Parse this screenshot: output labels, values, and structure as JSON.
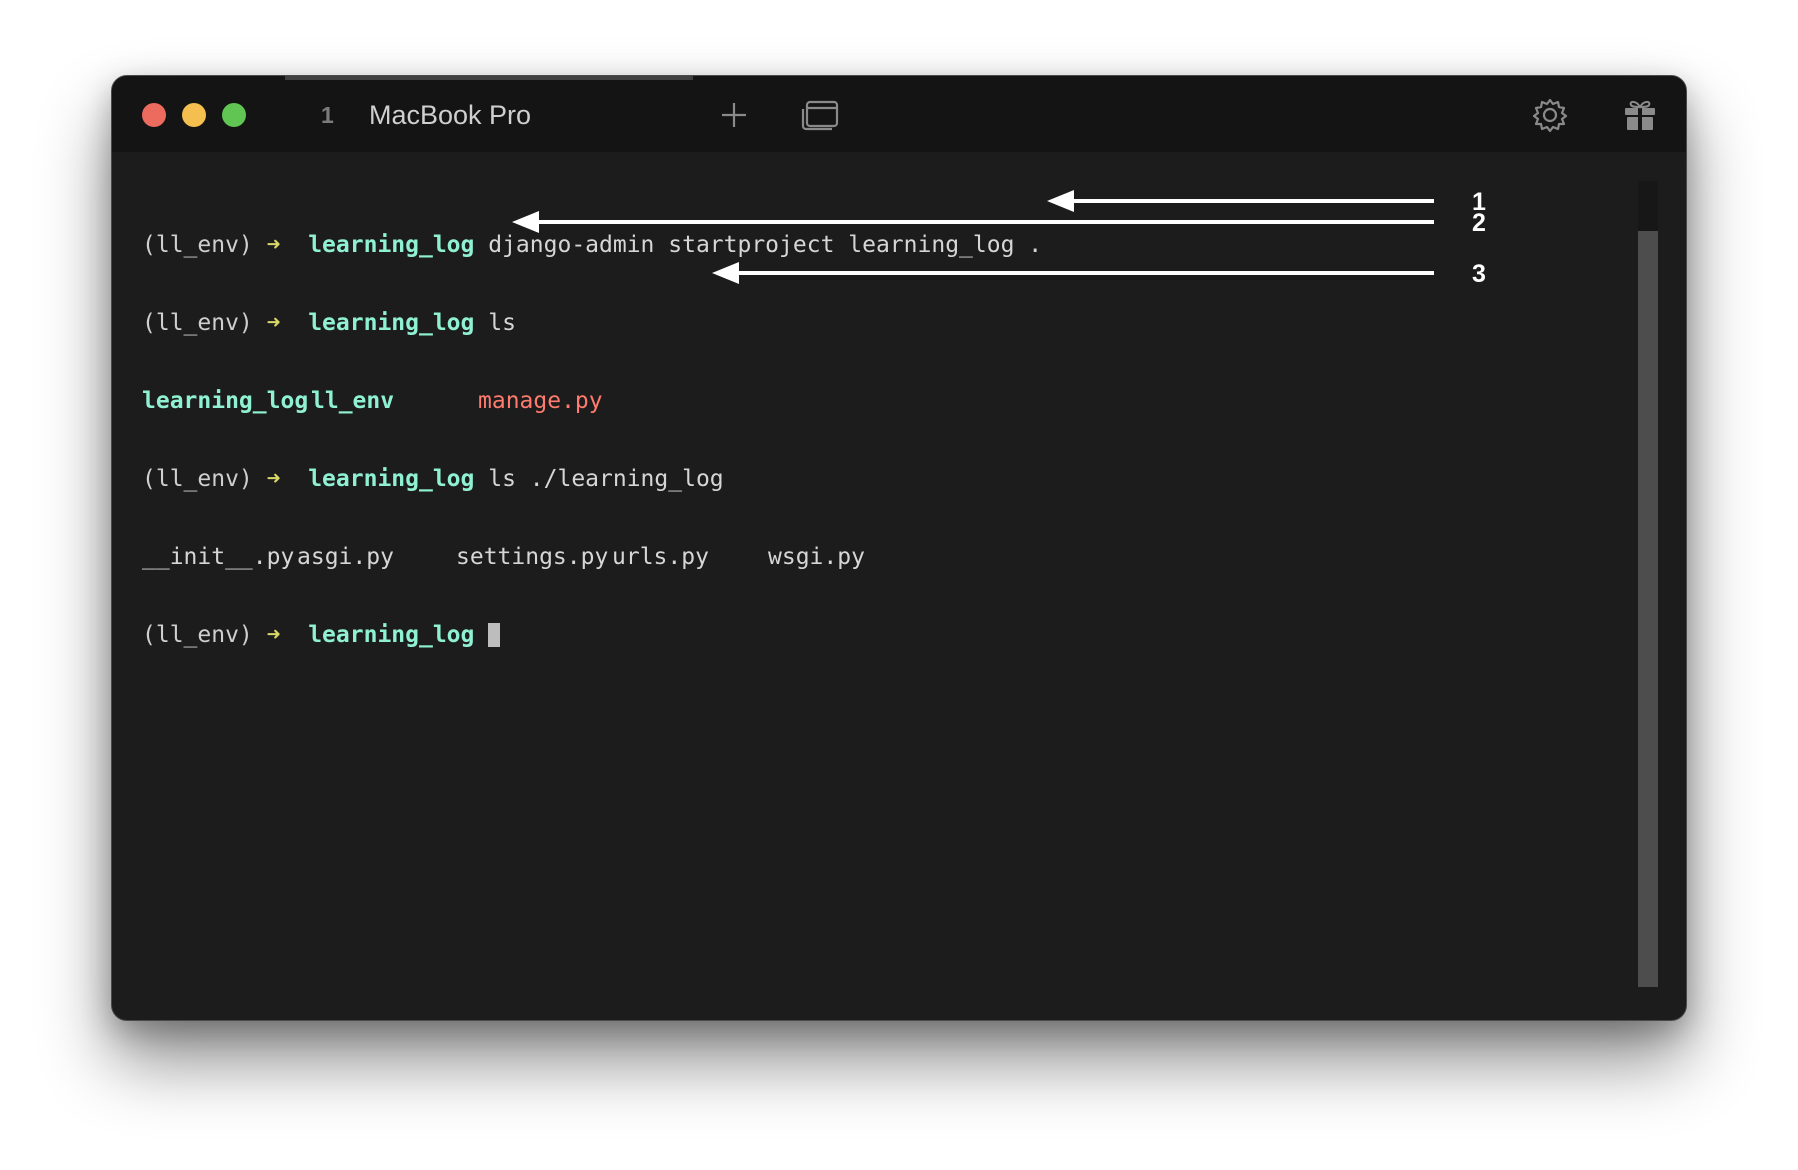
{
  "window": {
    "tab": {
      "index": "1",
      "title": "MacBook Pro"
    },
    "icons": [
      "close-button",
      "minimize-button",
      "maximize-button",
      "plus-icon",
      "window-icon",
      "gear-icon",
      "gift-icon"
    ]
  },
  "terminal": {
    "lines": [
      {
        "env": "(ll_env)",
        "arrow": "➜",
        "dir": "learning_log",
        "cmd": "django-admin startproject learning_log ."
      },
      {
        "env": "(ll_env)",
        "arrow": "➜",
        "dir": "learning_log",
        "cmd": "ls"
      },
      {
        "out": [
          "learning_log",
          "ll_env",
          "manage.py"
        ]
      },
      {
        "env": "(ll_env)",
        "arrow": "➜",
        "dir": "learning_log",
        "cmd": "ls ./learning_log"
      },
      {
        "out": [
          "__init__.py",
          "asgi.py",
          "settings.py",
          "urls.py",
          "wsgi.py"
        ]
      },
      {
        "env": "(ll_env)",
        "arrow": "➜",
        "dir": "learning_log",
        "cmd": ""
      }
    ]
  },
  "annotations": {
    "labels": [
      "1",
      "2",
      "3"
    ]
  },
  "colors": {
    "background": "#1c1c1c",
    "titlebar": "#141414",
    "directory": "#8ff0d2",
    "prompt_arrow": "#d8d86a",
    "executable": "#ff7b6e",
    "annotation": "#ffffff"
  }
}
